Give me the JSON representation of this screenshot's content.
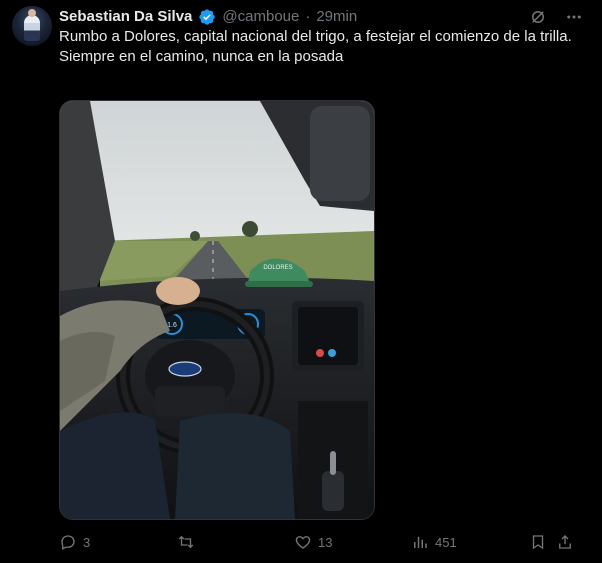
{
  "author": {
    "name": "Sebastian Da Silva",
    "handle": "@camboue",
    "separator": "·",
    "time": "29min",
    "verified": true
  },
  "tweet": {
    "line1": "Rumbo a Dolores, capital nacional del trigo, a festejar el comienzo de la trilla.",
    "line2": "Siempre en el camino, nunca en la posada"
  },
  "media": {
    "speed_left": "1.6",
    "speed_right": "103",
    "cap_text": "DOLORES"
  },
  "actions": {
    "replies": "3",
    "retweets": "",
    "likes": "13",
    "views": "451"
  },
  "icons": [
    "grok-icon",
    "more-icon",
    "reply-icon",
    "retweet-icon",
    "like-icon",
    "views-icon",
    "bookmark-icon",
    "share-icon",
    "verified-badge-icon"
  ],
  "colors": {
    "background": "#000000",
    "text": "#e7e9ea",
    "muted": "#71767b",
    "verified": "#1d9bf0"
  }
}
